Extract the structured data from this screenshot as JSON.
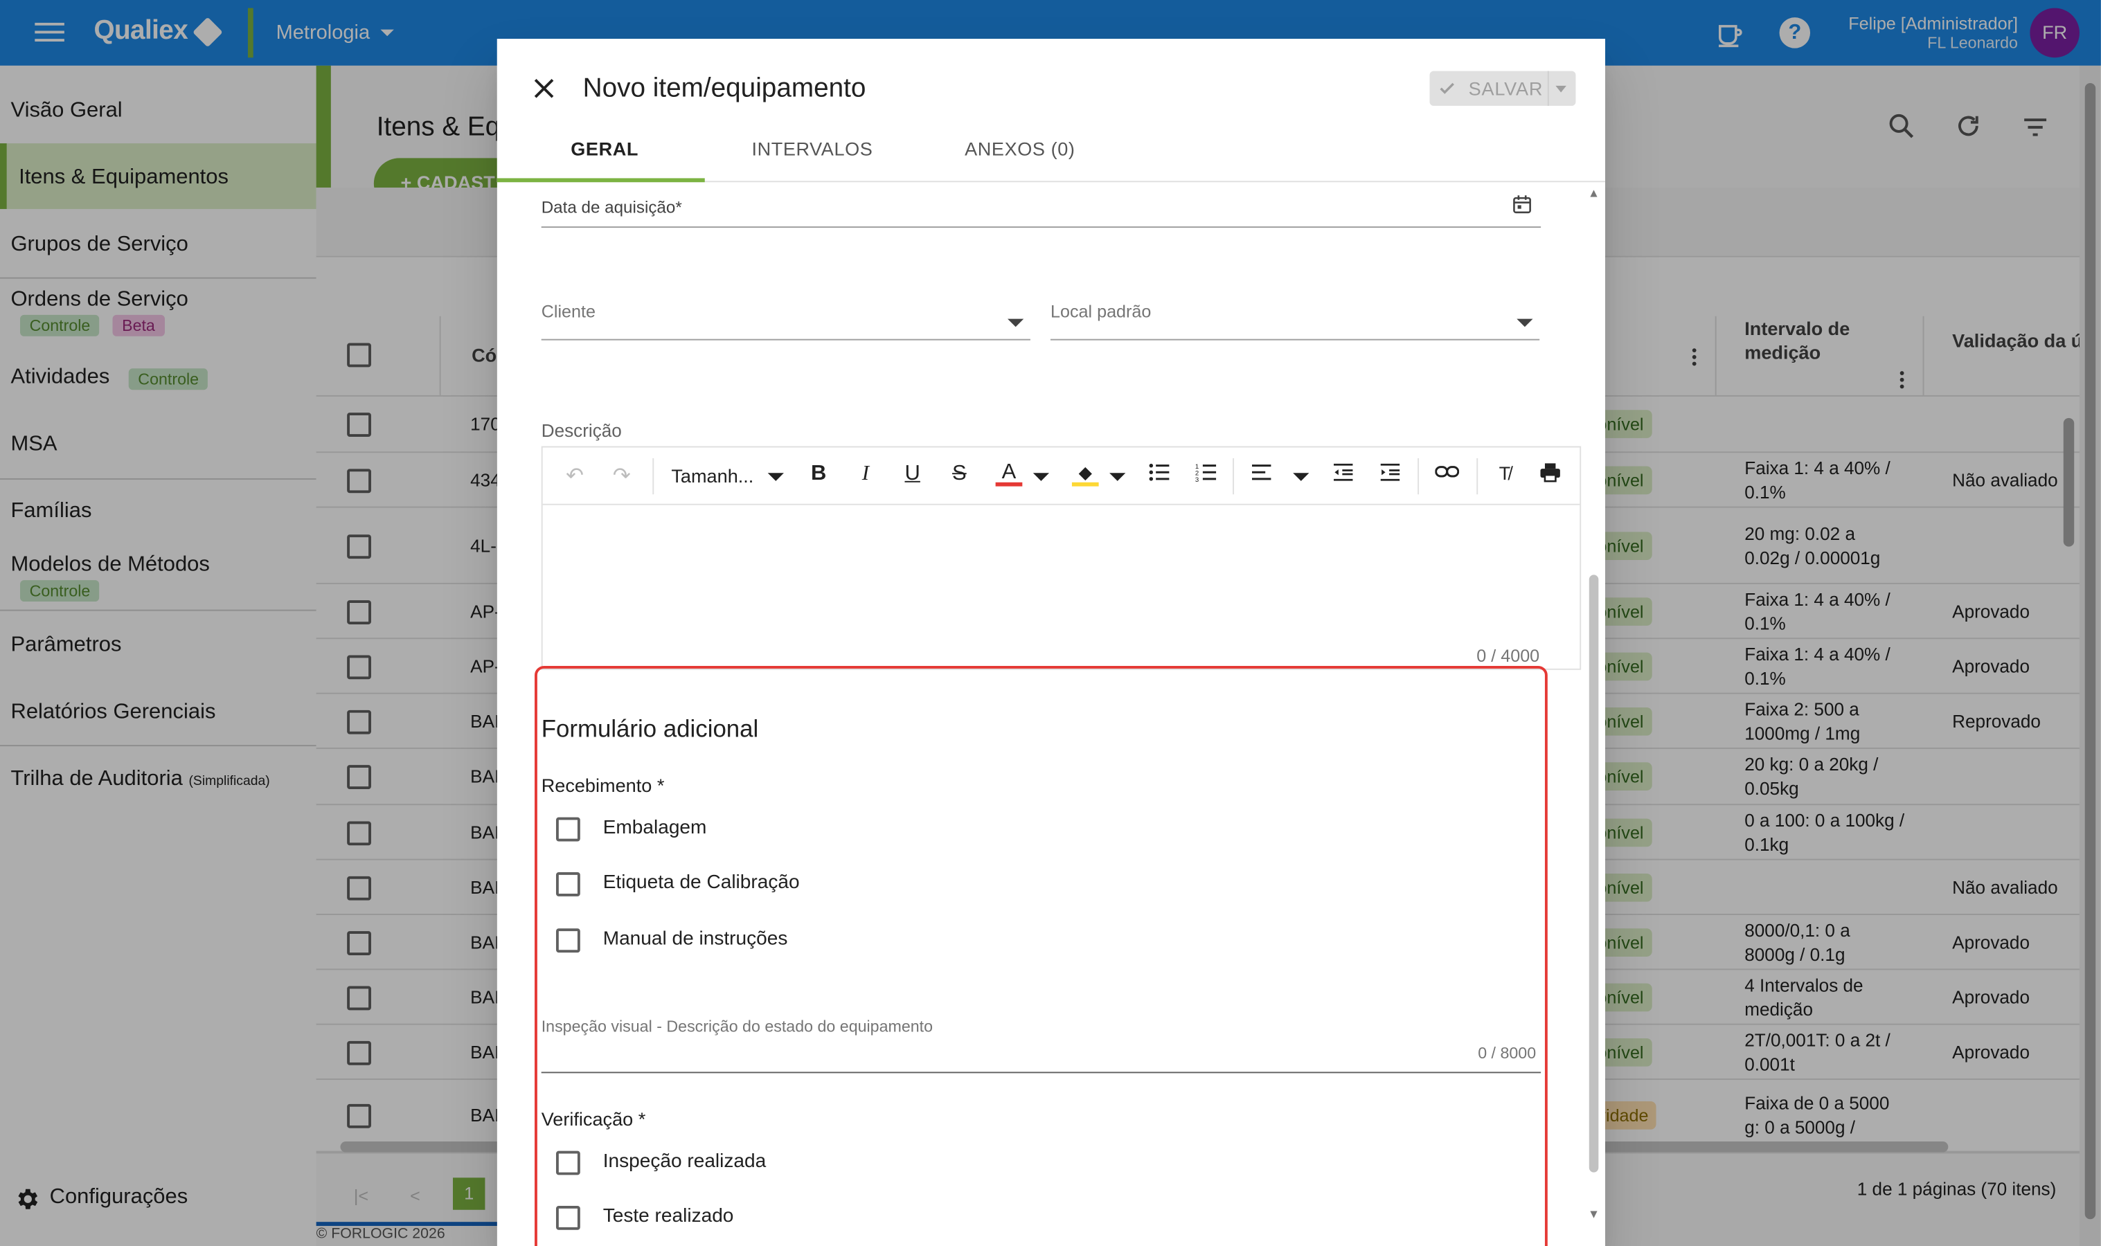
{
  "topbar": {
    "app_name": "Qualiex",
    "module": "Metrologia",
    "user_name": "Felipe [Administrador]",
    "user_sub": "FL Leonardo",
    "avatar_initials": "FR",
    "help_label": "?"
  },
  "sidebar": {
    "items": [
      {
        "label": "Visão Geral"
      },
      {
        "label": "Itens & Equipamentos"
      },
      {
        "label": "Grupos de Serviço"
      },
      {
        "label": "Ordens de Serviço",
        "badges": [
          "Controle",
          "Beta"
        ]
      },
      {
        "label": "Atividades",
        "badges": [
          "Controle"
        ]
      },
      {
        "label": "MSA"
      },
      {
        "label": "Famílias"
      },
      {
        "label": "Modelos de Métodos",
        "badges": [
          "Controle"
        ]
      },
      {
        "label": "Parâmetros"
      },
      {
        "label": "Relatórios Gerenciais"
      },
      {
        "label": "Trilha de Auditoria",
        "suffix": "(Simplificada)"
      }
    ],
    "settings_label": "Configurações"
  },
  "main": {
    "title": "Itens & Eq",
    "add_button": "+ CADAST",
    "columns": {
      "code": "Có",
      "interval": "Intervalo de medição",
      "validation": "Validação da última calibr"
    },
    "rows": [
      {
        "code": "170",
        "status": "onível",
        "interval": "",
        "validation": ""
      },
      {
        "code": "434",
        "status": "onível",
        "interval": "Faixa 1: 4 a 40% / 0.1%",
        "validation": "Não avaliado"
      },
      {
        "code": "4L-",
        "status": "onível",
        "interval": "20 mg: 0.02 a 0.02g / 0.00001g",
        "validation": ""
      },
      {
        "code": "AP-",
        "status": "onível",
        "interval": "Faixa 1: 4 a 40% / 0.1%",
        "validation": "Aprovado"
      },
      {
        "code": "AP-",
        "status": "onível",
        "interval": "Faixa 1: 4 a 40% / 0.1%",
        "validation": "Aprovado"
      },
      {
        "code": "BAI",
        "status": "onível",
        "interval": "Faixa 2: 500 a 1000mg / 1mg",
        "validation": "Reprovado"
      },
      {
        "code": "BAI",
        "status": "onível",
        "interval": "20 kg: 0 a 20kg / 0.05kg",
        "validation": ""
      },
      {
        "code": "BAI",
        "status": "onível",
        "interval": "0 a 100: 0 a 100kg / 0.1kg",
        "validation": ""
      },
      {
        "code": "BAI",
        "status": "onível",
        "interval": "",
        "validation": "Não avaliado"
      },
      {
        "code": "BAI",
        "status": "onível",
        "interval": "8000/0,1: 0 a 8000g / 0.1g",
        "validation": "Aprovado"
      },
      {
        "code": "BAI",
        "status": "onível",
        "interval": "4 Intervalos de medição",
        "validation": "Aprovado"
      },
      {
        "code": "BAI",
        "status": "onível",
        "interval": "2T/0,001T: 0 a 2t / 0.001t",
        "validation": "Aprovado"
      },
      {
        "code": "BAI",
        "status": "vidade",
        "interval": "Faixa de 0 a 5000 g: 0 a 5000g /",
        "validation": ""
      }
    ],
    "pagination": {
      "current_page": "1",
      "summary": "1 de 1 páginas (70 itens)"
    },
    "footer": "© FORLOGIC 2026"
  },
  "dialog": {
    "title": "Novo item/equipamento",
    "save_label": "SALVAR",
    "tabs": [
      "GERAL",
      "INTERVALOS",
      "ANEXOS (0)"
    ],
    "fields": {
      "acquisition_date": "Data de aquisição*",
      "client": "Cliente",
      "default_location": "Local padrão",
      "description": "Descrição",
      "editor_font_size": "Tamanh...",
      "editor_counter": "0 / 4000"
    },
    "additional_form": {
      "title": "Formulário adicional",
      "receipt_label": "Recebimento *",
      "receipt_options": [
        "Embalagem",
        "Etiqueta de Calibração",
        "Manual de instruções"
      ],
      "visual_inspection_label": "Inspeção visual - Descrição do estado do equipamento",
      "visual_inspection_counter": "0 / 8000",
      "verification_label": "Verificação *",
      "verification_options": [
        "Inspeção realizada",
        "Teste realizado"
      ]
    }
  },
  "colors": {
    "topbar": "#1e88e5",
    "accent_green": "#7cb342",
    "highlight_red": "#e53935",
    "avatar": "#7b1fa2"
  }
}
